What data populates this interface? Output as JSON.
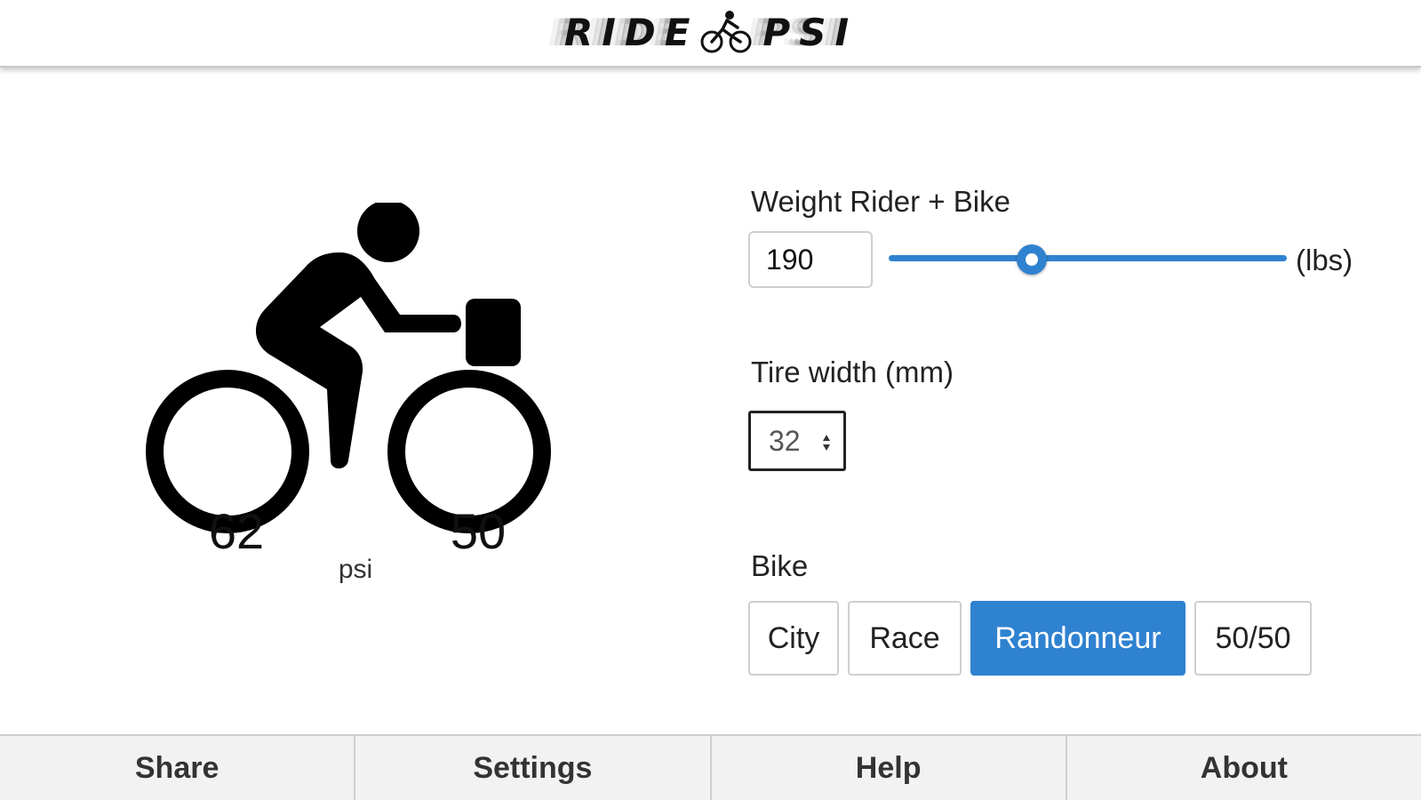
{
  "header": {
    "logo_left": "RIDE",
    "logo_right": "PSI"
  },
  "pressure": {
    "front": "62",
    "rear": "50",
    "unit": "psi"
  },
  "weight": {
    "label": "Weight Rider + Bike",
    "value": "190",
    "unit": "(lbs)",
    "slider_fraction": 0.36
  },
  "tire": {
    "label": "Tire width (mm)",
    "value": "32"
  },
  "bike": {
    "label": "Bike",
    "options": [
      "City",
      "Race",
      "Randonneur",
      "50/50"
    ],
    "selected": "Randonneur"
  },
  "footer": {
    "tabs": [
      "Share",
      "Settings",
      "Help",
      "About"
    ]
  },
  "colors": {
    "accent": "#2f82d0",
    "footer_bg": "#f2f2f2"
  },
  "icons": [
    "bicycle-logo-icon",
    "rider-icon",
    "select-arrows-icon"
  ]
}
